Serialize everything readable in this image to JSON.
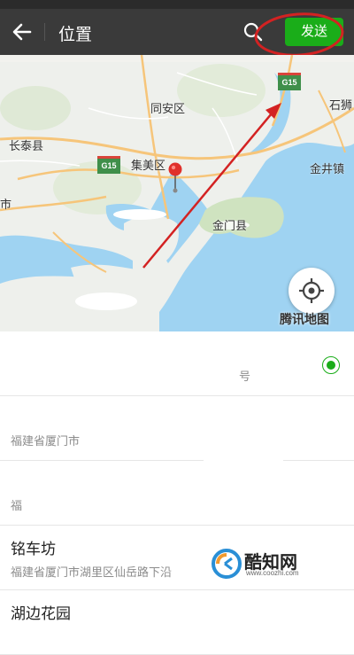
{
  "navbar": {
    "title": "位置",
    "send_label": "发送"
  },
  "map": {
    "labels": {
      "tongan": "同安区",
      "changtai": "长泰县",
      "jimei": "集美区",
      "shishi": "石狮",
      "jinjing": "金井镇",
      "shi": "市",
      "dengshan": "金门县"
    },
    "highways": [
      "G15",
      "G15"
    ],
    "brand": "腾讯地图"
  },
  "locations": [
    {
      "name": "",
      "address": "",
      "selected": true,
      "suffix": "号"
    },
    {
      "name": "",
      "address": "福建省厦门市",
      "selected": false
    },
    {
      "name": "",
      "address": "福",
      "selected": false
    },
    {
      "name": "铭车坊",
      "address": "福建省厦门市湖里区仙岳路下沿",
      "selected": false
    },
    {
      "name": "湖边花园",
      "address": "",
      "selected": false
    }
  ],
  "watermark": {
    "text": "酷知网",
    "url": "www.coozhi.com"
  },
  "colors": {
    "navbar": "#3a3a3a",
    "send_button": "#1aad19",
    "annotation": "#d32222",
    "water": "#9fd3f2"
  }
}
